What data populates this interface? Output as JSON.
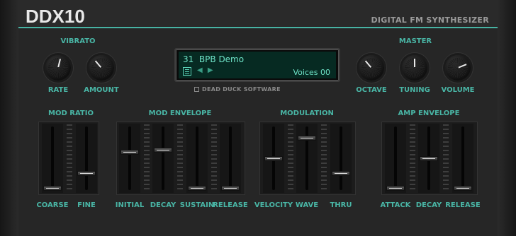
{
  "header": {
    "title": "DDX10",
    "subtitle": "DIGITAL FM SYNTHESIZER"
  },
  "vibrato": {
    "title": "VIBRATO",
    "rate_label": "RATE",
    "amount_label": "AMOUNT"
  },
  "master": {
    "title": "MASTER",
    "octave_label": "OCTAVE",
    "tuning_label": "TUNING",
    "volume_label": "VOLUME"
  },
  "display": {
    "preset_number": "31",
    "preset_name": "BPB Demo",
    "voices": "Voices 00",
    "nav_arrows": "◀ ▶"
  },
  "brand": "DEAD DUCK SOFTWARE",
  "sections": {
    "mod_ratio": "MOD RATIO",
    "mod_envelope": "MOD ENVELOPE",
    "modulation": "MODULATION",
    "amp_envelope": "AMP ENVELOPE"
  },
  "sliders": {
    "coarse": "COARSE",
    "fine": "FINE",
    "initial": "INITIAL",
    "decay": "DECAY",
    "sustain": "SUSTAIN",
    "release": "RELEASE",
    "velocity": "VELOCITY",
    "wave": "WAVE",
    "thru": "THRU",
    "attack": "ATTACK",
    "amp_decay": "DECAY",
    "amp_release": "RELEASE"
  },
  "slider_levels": {
    "coarse": 0.0,
    "fine": 0.25,
    "initial": 0.6,
    "decay": 0.63,
    "sustain": 0.0,
    "release": 0.0,
    "velocity": 0.5,
    "wave": 0.83,
    "thru": 0.25,
    "attack": 0.0,
    "amp_decay": 0.5,
    "amp_release": 0.0
  },
  "knob_levels": {
    "rate": 0.55,
    "amount": 0.35,
    "octave": 0.35,
    "tuning": 0.5,
    "volume": 0.75
  },
  "colors": {
    "accent": "#49b5a5",
    "lcd_bg": "#062a22",
    "lcd_text": "#6fe4c8"
  }
}
